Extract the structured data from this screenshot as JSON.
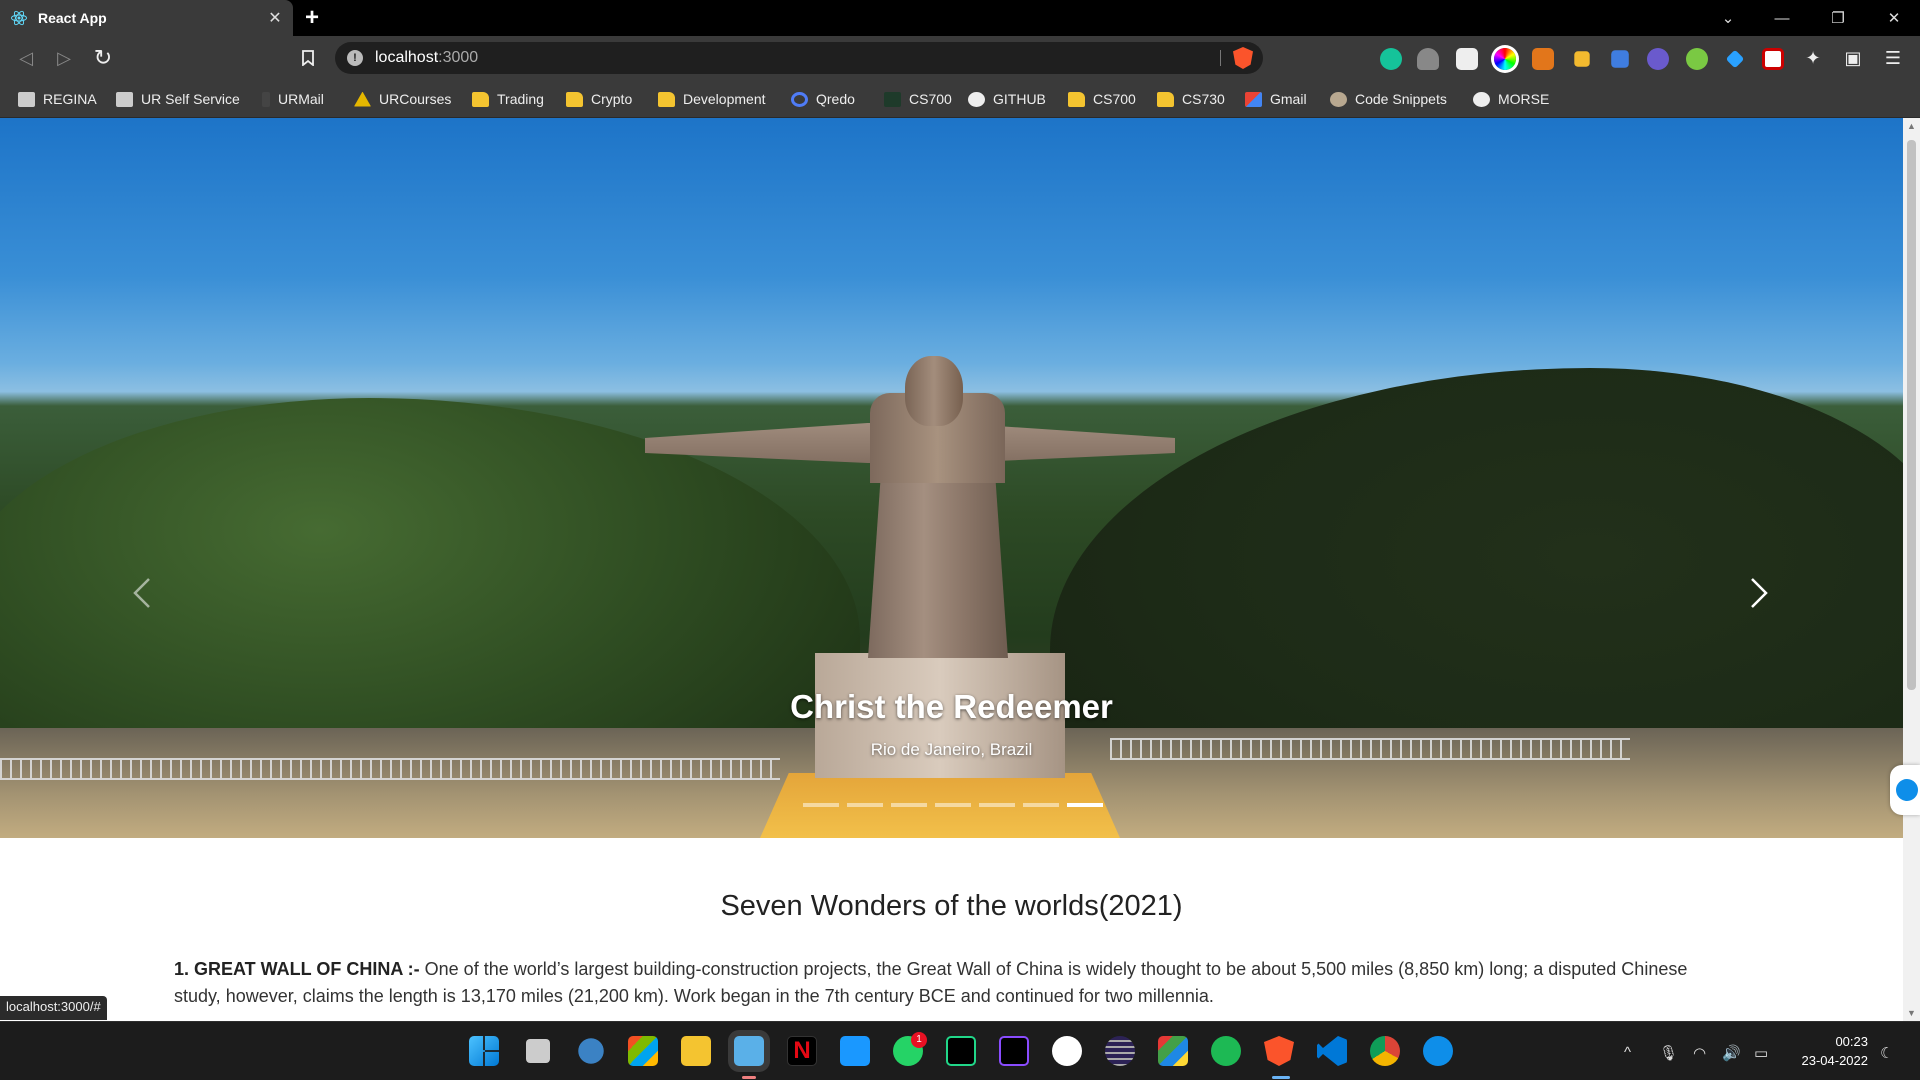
{
  "browser": {
    "tab_title": "React App",
    "new_tab_symbol": "+",
    "url_host": "localhost",
    "url_port": ":3000"
  },
  "bookmarks": [
    {
      "label": "REGINA",
      "icon": "regina-favicon"
    },
    {
      "label": "UR Self Service",
      "icon": "ur-favicon"
    },
    {
      "label": "URMail",
      "icon": "urmail-favicon"
    },
    {
      "label": "URCourses",
      "icon": "urcourses-favicon"
    },
    {
      "label": "Trading",
      "icon": "folder-icon"
    },
    {
      "label": "Crypto",
      "icon": "folder-icon"
    },
    {
      "label": "Development",
      "icon": "folder-icon"
    },
    {
      "label": "Qredo",
      "icon": "qredo-favicon"
    },
    {
      "label": "CS700",
      "icon": "cs700-favicon"
    },
    {
      "label": "GITHUB",
      "icon": "github-icon"
    },
    {
      "label": "CS700",
      "icon": "folder-icon"
    },
    {
      "label": "CS730",
      "icon": "folder-icon"
    },
    {
      "label": "Gmail",
      "icon": "gmail-icon"
    },
    {
      "label": "Code Snippets",
      "icon": "code-snippets-favicon"
    },
    {
      "label": "MORSE",
      "icon": "github-icon"
    }
  ],
  "carousel": {
    "caption_title": "Christ the Redeemer",
    "caption_subtitle": "Rio de Janeiro, Brazil",
    "slide_count": 7,
    "active_slide": 7
  },
  "content": {
    "page_title": "Seven Wonders of the worlds(2021)",
    "wonders": [
      {
        "name": "1. GREAT WALL OF CHINA :-",
        "text": " One of the world’s largest building-construction projects, the Great Wall of China is widely thought to be about 5,500 miles (8,850 km) long; a disputed Chinese study, however, claims the length is 13,170 miles (21,200 km). Work began in the 7th century BCE and continued for two millennia."
      }
    ]
  },
  "status_bar": {
    "link_preview": "localhost:3000/#"
  },
  "taskbar": {
    "whatsapp_badge": "1",
    "time": "00:23",
    "date": "23-04-2022"
  },
  "colors": {
    "chrome_dark": "#3a3a3a",
    "tabbar": "#000000",
    "brave_orange": "#fb542b",
    "folder_yellow": "#f4c430",
    "taskbar": "#1c1c1c"
  }
}
